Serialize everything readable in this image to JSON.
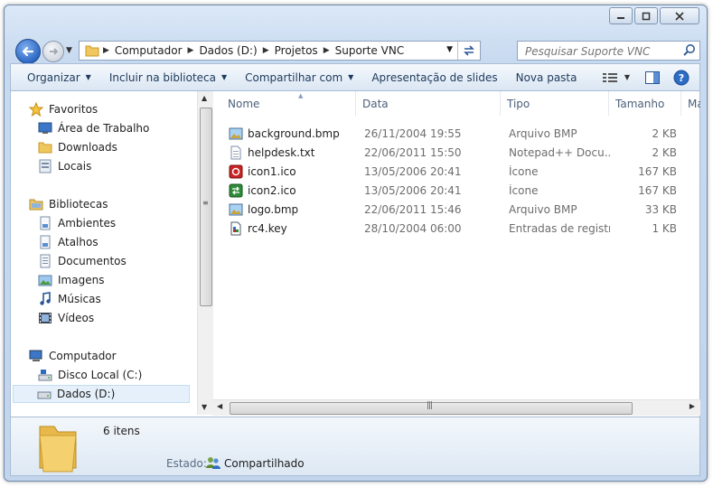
{
  "address": {
    "segments": [
      "Computador",
      "Dados (D:)",
      "Projetos",
      "Suporte VNC"
    ]
  },
  "search": {
    "placeholder": "Pesquisar Suporte VNC"
  },
  "commands": {
    "organize": "Organizar",
    "include_library": "Incluir na biblioteca",
    "share_with": "Compartilhar com",
    "slideshow": "Apresentação de slides",
    "new_folder": "Nova pasta"
  },
  "nav": {
    "favorites": "Favoritos",
    "desktop": "Área de Trabalho",
    "downloads": "Downloads",
    "places": "Locais",
    "libraries": "Bibliotecas",
    "environments": "Ambientes",
    "shortcuts": "Atalhos",
    "documents": "Documentos",
    "images": "Imagens",
    "music": "Músicas",
    "videos": "Vídeos",
    "computer": "Computador",
    "local_disk": "Disco Local (C:)",
    "data_drive": "Dados (D:)"
  },
  "columns": {
    "name": "Nome",
    "date": "Data",
    "type": "Tipo",
    "size": "Tamanho",
    "more": "Ma"
  },
  "files": [
    {
      "name": "background.bmp",
      "date": "26/11/2004 19:55",
      "type": "Arquivo BMP",
      "size": "2 KB",
      "icon": "bmp-icon"
    },
    {
      "name": "helpdesk.txt",
      "date": "22/06/2011 15:50",
      "type": "Notepad++ Docu...",
      "size": "2 KB",
      "icon": "text-file-icon"
    },
    {
      "name": "icon1.ico",
      "date": "13/05/2006 20:41",
      "type": "Ícone",
      "size": "167 KB",
      "icon": "red-ico-icon"
    },
    {
      "name": "icon2.ico",
      "date": "13/05/2006 20:41",
      "type": "Ícone",
      "size": "167 KB",
      "icon": "green-ico-icon"
    },
    {
      "name": "logo.bmp",
      "date": "22/06/2011 15:46",
      "type": "Arquivo BMP",
      "size": "33 KB",
      "icon": "bmp-icon"
    },
    {
      "name": "rc4.key",
      "date": "28/10/2004 06:00",
      "type": "Entradas de registro",
      "size": "1 KB",
      "icon": "registry-icon"
    }
  ],
  "details": {
    "count": "6 itens",
    "state_label": "Estado:",
    "state_value": "Compartilhado"
  },
  "colors": {
    "accent": "#2b5797",
    "selection": "#e5f0fb",
    "folder": "#f0c75e"
  }
}
